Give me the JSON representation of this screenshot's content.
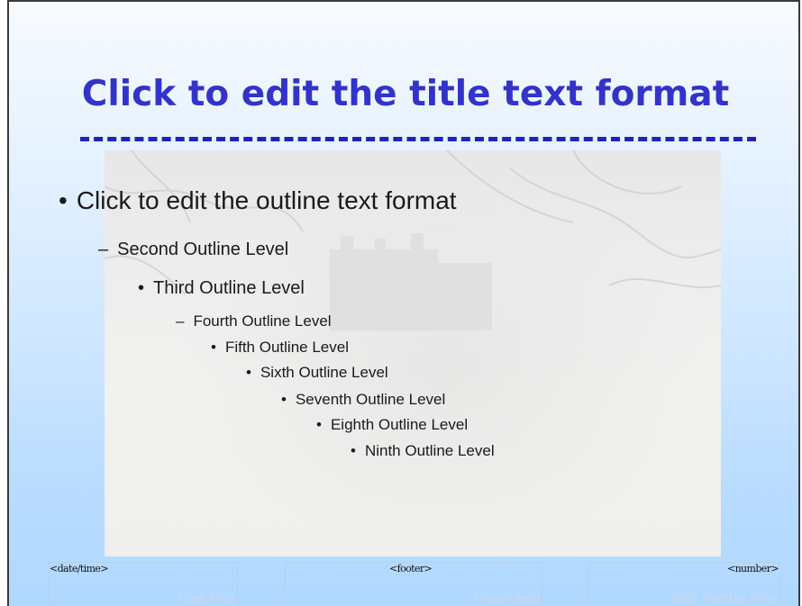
{
  "slide": {
    "title": "Click to edit the title text format",
    "outline": [
      {
        "marker": "•",
        "text": "Click to edit the outline text format"
      },
      {
        "marker": "–",
        "text": "Second Outline Level"
      },
      {
        "marker": "•",
        "text": "Third Outline Level"
      },
      {
        "marker": "–",
        "text": "Fourth Outline Level"
      },
      {
        "marker": "•",
        "text": "Fifth Outline Level"
      },
      {
        "marker": "•",
        "text": "Sixth Outline Level"
      },
      {
        "marker": "•",
        "text": "Seventh Outline Level"
      },
      {
        "marker": "•",
        "text": "Eighth Outline Level"
      },
      {
        "marker": "•",
        "text": "Ninth Outline Level"
      }
    ],
    "footer": {
      "date_placeholder": "<date/time>",
      "date_area": "Date Area",
      "footer_placeholder": "<footer>",
      "footer_area": "Footer Area",
      "number_placeholder": "<number>",
      "number_area": "Slide Number Area"
    }
  },
  "colors": {
    "title": "#3333cc",
    "title_rule": "#2222bb",
    "gradient_top": "#f7fbff",
    "gradient_bottom": "#b0d8ff"
  }
}
